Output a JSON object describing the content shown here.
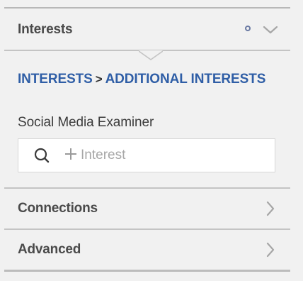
{
  "sections": {
    "interests": {
      "title": "Interests",
      "state": "expanded",
      "breadcrumb": {
        "level1": "INTERESTS",
        "separator": ">",
        "level2": "ADDITIONAL INTERESTS"
      },
      "selected_interest": "Social Media Examiner",
      "search": {
        "placeholder": "Interest",
        "value": ""
      }
    },
    "connections": {
      "title": "Connections",
      "state": "collapsed"
    },
    "advanced": {
      "title": "Advanced",
      "state": "collapsed"
    }
  },
  "colors": {
    "background": "#f1f1f1",
    "link_blue": "#2f5ea6",
    "indicator_dot": "#6a7aa3",
    "chevron": "#a6a6a6"
  },
  "icons": {
    "interests_indicator": "status-dot-icon",
    "interests_toggle": "chevron-down-icon",
    "search": "search-icon",
    "add": "plus-icon",
    "connections_toggle": "chevron-right-icon",
    "advanced_toggle": "chevron-right-icon"
  }
}
